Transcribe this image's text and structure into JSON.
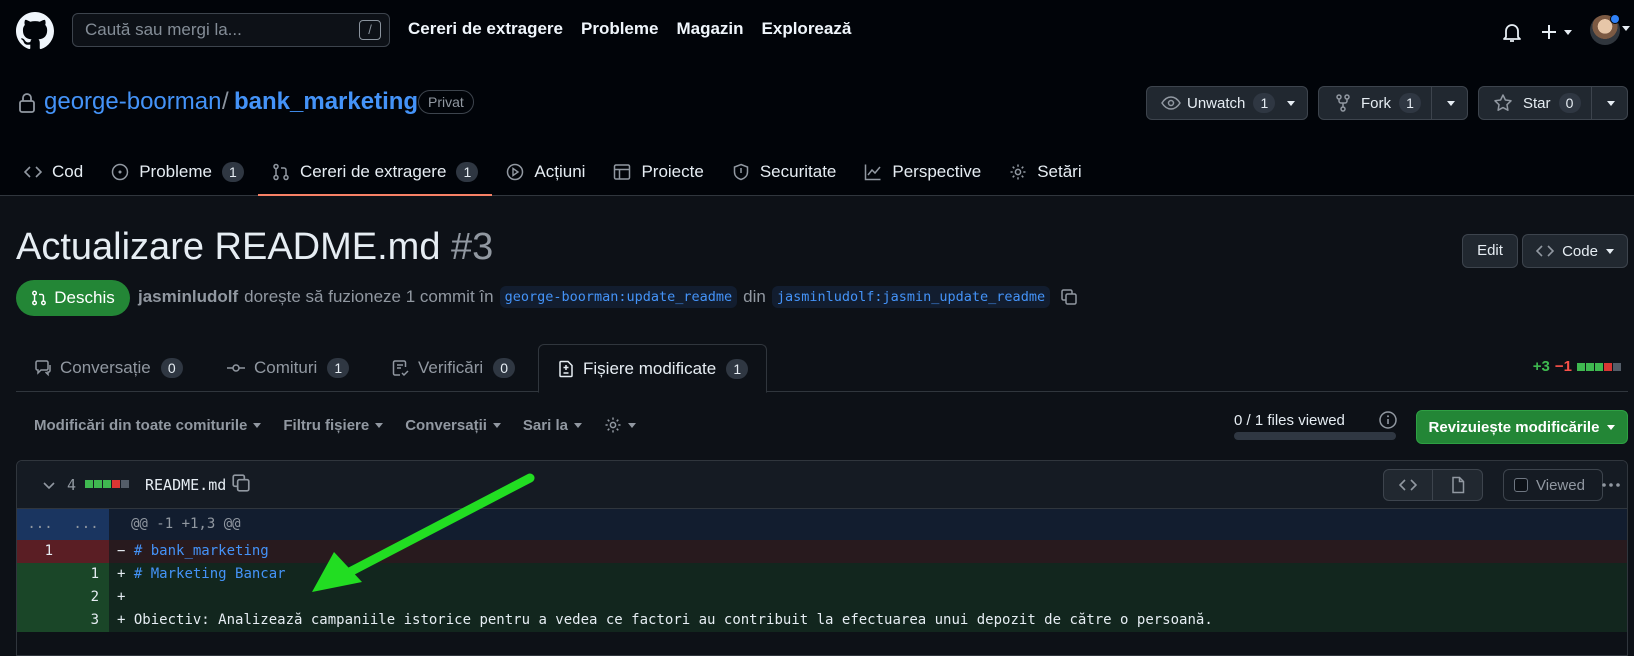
{
  "header": {
    "search_placeholder": "Caută sau mergi la...",
    "search_key": "/",
    "nav": [
      "Cereri de extragere",
      "Probleme",
      "Magazin",
      "Explorează"
    ]
  },
  "repo": {
    "owner": "george-boorman",
    "separator": "/",
    "name": "bank_marketing",
    "visibility": "Privat",
    "unwatch_label": "Unwatch",
    "unwatch_count": "1",
    "fork_label": "Fork",
    "fork_count": "1",
    "star_label": "Star",
    "star_count": "0",
    "tabs": [
      {
        "label": "Cod",
        "count": ""
      },
      {
        "label": "Probleme",
        "count": "1"
      },
      {
        "label": "Cereri de extragere",
        "count": "1"
      },
      {
        "label": "Acțiuni",
        "count": ""
      },
      {
        "label": "Proiecte",
        "count": ""
      },
      {
        "label": "Securitate",
        "count": ""
      },
      {
        "label": "Perspective",
        "count": ""
      },
      {
        "label": "Setări",
        "count": ""
      }
    ]
  },
  "pr": {
    "title": "Actualizare README.md",
    "number": "#3",
    "edit_label": "Edit",
    "code_label": "Code",
    "state": "Deschis",
    "author": "jasminludolf",
    "merge_text": "dorește să fuzioneze 1 commit în",
    "base_branch": "george-boorman:update_readme",
    "from_text": "din",
    "head_branch": "jasminludolf:jasmin_update_readme",
    "tabs": [
      {
        "label": "Conversație",
        "count": "0"
      },
      {
        "label": "Comituri",
        "count": "1"
      },
      {
        "label": "Verificări",
        "count": "0"
      },
      {
        "label": "Fișiere modificate",
        "count": "1"
      }
    ],
    "additions": "+3",
    "deletions": "−1"
  },
  "toolbar": {
    "items": [
      "Modificări din toate comiturile",
      "Filtru fișiere",
      "Conversații",
      "Sari la"
    ],
    "files_viewed": "0 / 1 files viewed",
    "files_viewed_fraction": 0,
    "review_label": "Revizuiește modificările"
  },
  "file": {
    "changes": "4",
    "name": "README.md",
    "viewed_label": "Viewed",
    "hunk_left": "...",
    "hunk_right": "...",
    "hunk_header": "@@ -1 +1,3 @@",
    "lines": [
      {
        "type": "del",
        "old": "1",
        "new": "",
        "marker": "−",
        "text": "# bank_marketing"
      },
      {
        "type": "add",
        "old": "",
        "new": "1",
        "marker": "+",
        "text": "# Marketing Bancar"
      },
      {
        "type": "add",
        "old": "",
        "new": "2",
        "marker": "+",
        "text": ""
      },
      {
        "type": "add",
        "old": "",
        "new": "3",
        "marker": "+",
        "text": "Obiectiv: Analizează campaniile istorice pentru a vedea ce factori au contribuit la efectuarea unui depozit de către o persoană."
      }
    ]
  },
  "colors": {
    "accent_link": "#4493f8",
    "success": "#238636",
    "danger": "#f85149",
    "arrow": "#22dd22"
  }
}
